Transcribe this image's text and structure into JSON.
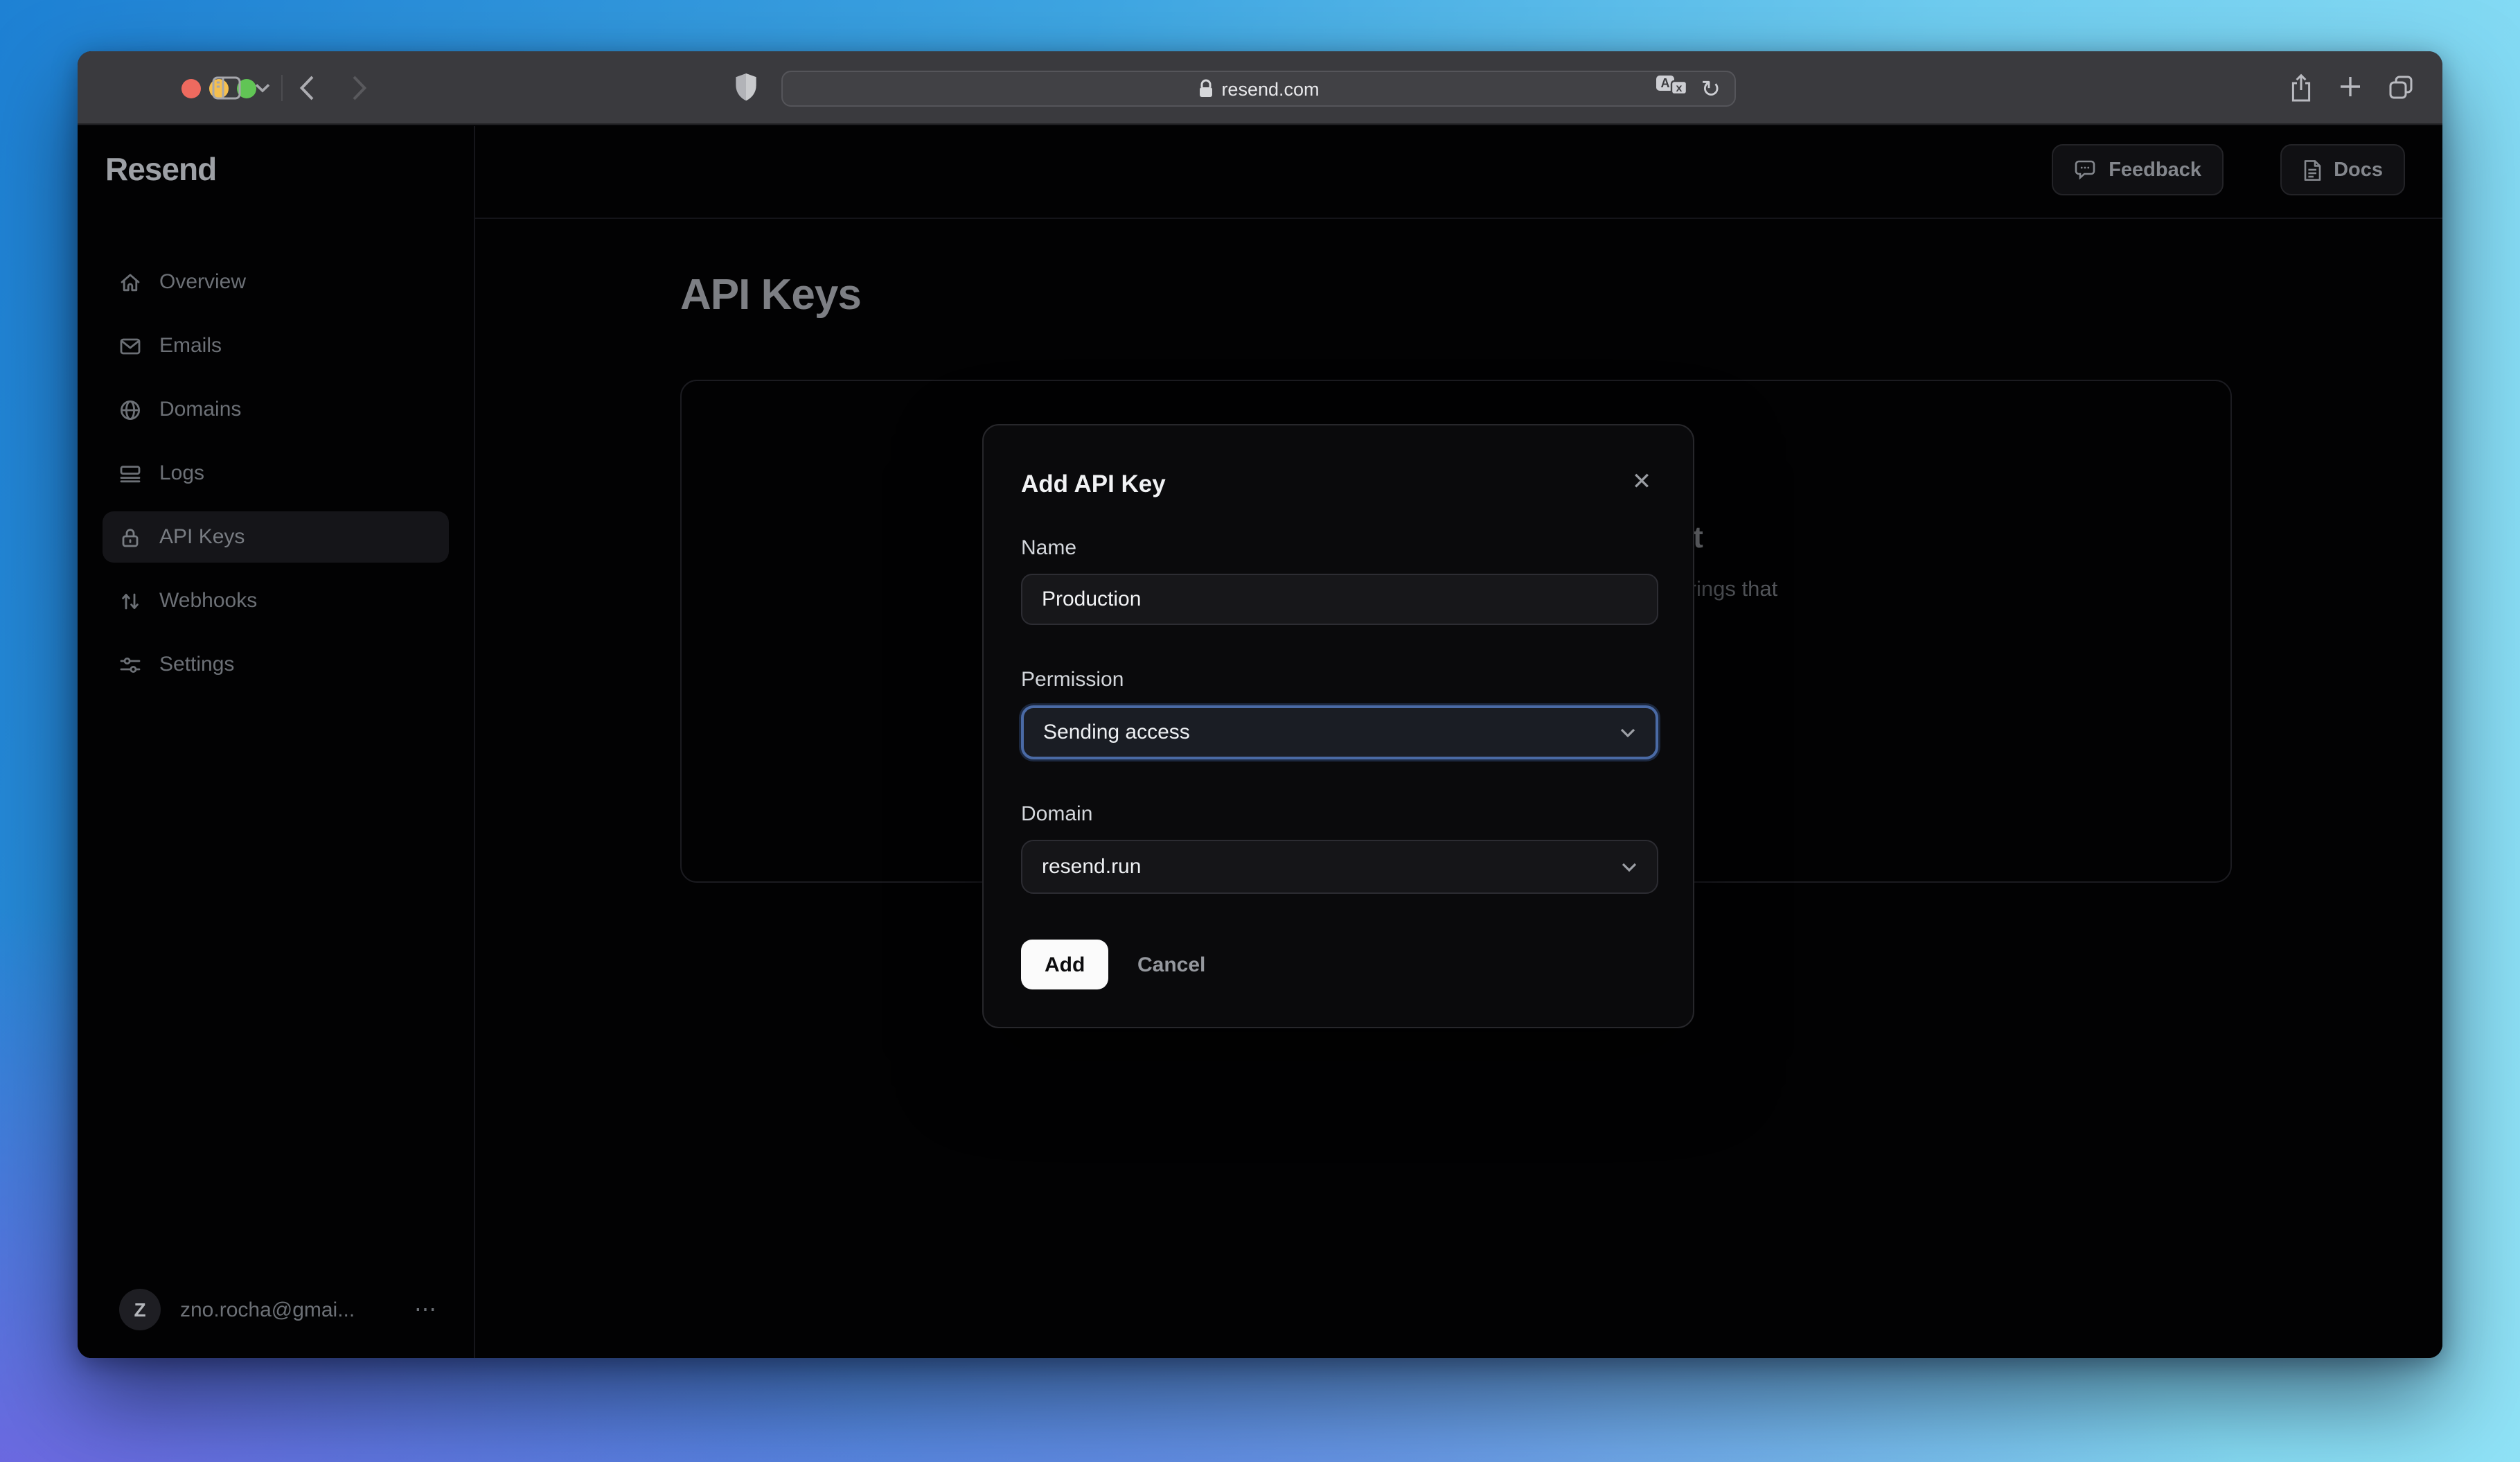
{
  "browser": {
    "url": "resend.com",
    "reload_glyph": "↻",
    "plus_glyph": "+",
    "tab_chevron_glyph": "⌄"
  },
  "sidebar": {
    "logo": "Resend",
    "items": [
      {
        "label": "Overview",
        "icon": "home-icon",
        "active": false
      },
      {
        "label": "Emails",
        "icon": "mail-icon",
        "active": false
      },
      {
        "label": "Domains",
        "icon": "globe-icon",
        "active": false
      },
      {
        "label": "Logs",
        "icon": "logs-icon",
        "active": false
      },
      {
        "label": "API Keys",
        "icon": "lock-icon",
        "active": true
      },
      {
        "label": "Webhooks",
        "icon": "arrows-icon",
        "active": false
      },
      {
        "label": "Settings",
        "icon": "sliders-icon",
        "active": false
      }
    ],
    "user": {
      "initial": "Z",
      "email": "zno.rocha@gmai...",
      "menu_glyph": "⋯"
    }
  },
  "header": {
    "feedback_label": "Feedback",
    "docs_label": "Docs"
  },
  "page": {
    "title": "API Keys",
    "empty_heading_fragment": "ys yet",
    "empty_body_fragment": "eric strings that"
  },
  "modal": {
    "title": "Add API Key",
    "close_glyph": "✕",
    "name_label": "Name",
    "name_value": "Production",
    "permission_label": "Permission",
    "permission_value": "Sending access",
    "domain_label": "Domain",
    "domain_value": "resend.run",
    "add_label": "Add",
    "cancel_label": "Cancel"
  },
  "colors": {
    "traffic_red": "#ee6a5f",
    "traffic_yellow": "#f5bf4f",
    "traffic_green": "#61c555",
    "focus_ring": "#4a6aa5"
  }
}
